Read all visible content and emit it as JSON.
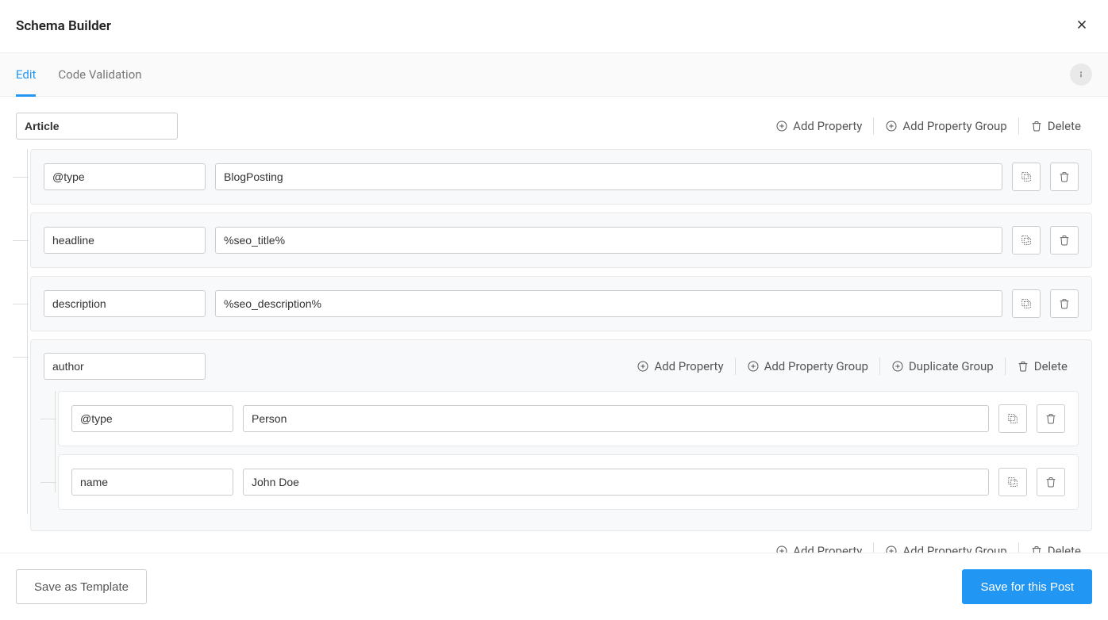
{
  "header": {
    "title": "Schema Builder"
  },
  "tabs": [
    {
      "label": "Edit",
      "active": true
    },
    {
      "label": "Code Validation",
      "active": false
    }
  ],
  "actions": {
    "add_property": "Add Property",
    "add_property_group": "Add Property Group",
    "duplicate_group": "Duplicate Group",
    "delete": "Delete"
  },
  "schema": {
    "group_label": "Article",
    "rows": [
      {
        "key": "@type",
        "value": "BlogPosting"
      },
      {
        "key": "headline",
        "value": "%seo_title%"
      },
      {
        "key": "description",
        "value": "%seo_description%"
      }
    ],
    "subgroup": {
      "label": "author",
      "rows": [
        {
          "key": "@type",
          "value": "Person"
        },
        {
          "key": "name",
          "value": "John Doe"
        }
      ]
    }
  },
  "footer": {
    "save_template": "Save as Template",
    "save_post": "Save for this Post"
  }
}
